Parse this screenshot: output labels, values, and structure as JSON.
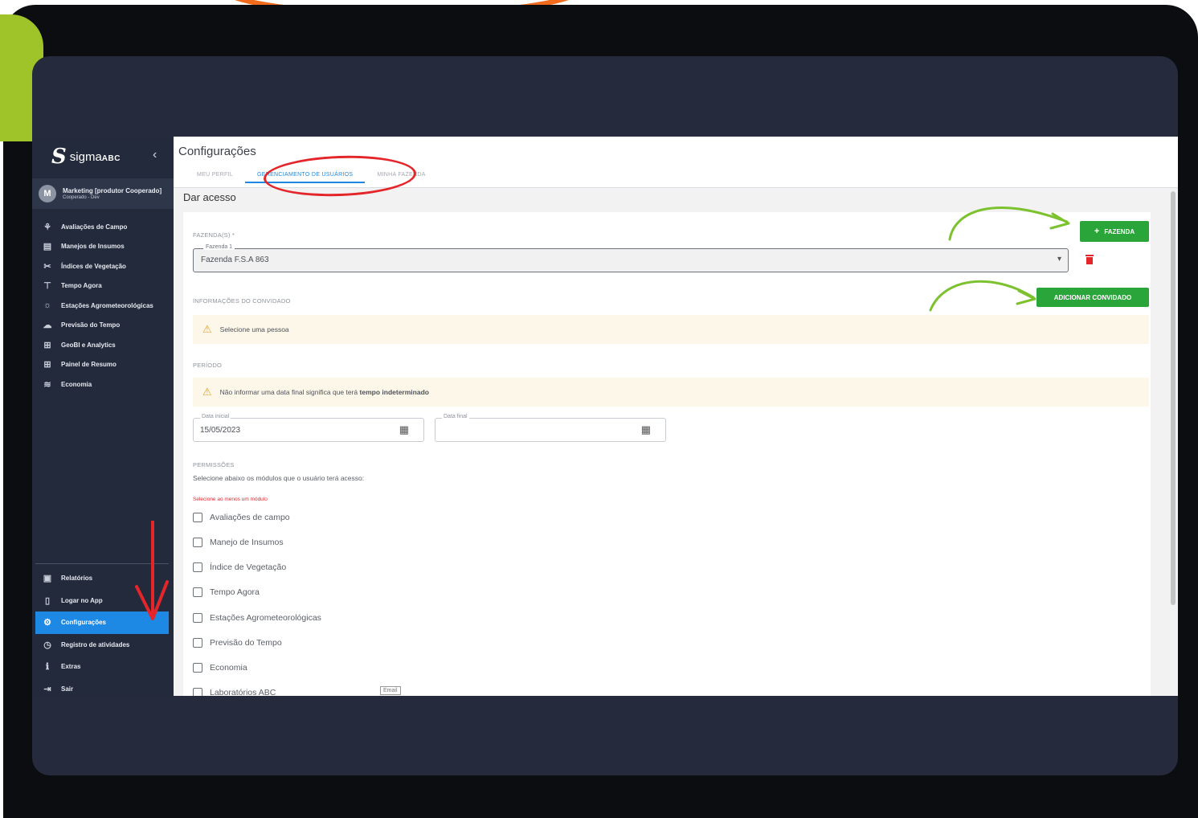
{
  "brand": {
    "logo_mark": "S",
    "logo_name": "sigma",
    "logo_suffix": "ABC"
  },
  "user": {
    "initial": "M",
    "name": "Marketing [produtor Cooperado]",
    "org": "Cooperado - Dev"
  },
  "sidebar": {
    "items": [
      {
        "label": "Avaliações de Campo",
        "icon": "field-icon"
      },
      {
        "label": "Manejos de Insumos",
        "icon": "supplies-icon"
      },
      {
        "label": "Índices de Vegetação",
        "icon": "vegetation-icon"
      },
      {
        "label": "Tempo Agora",
        "icon": "weather-station-icon"
      },
      {
        "label": "Estações Agrometeorológicas",
        "icon": "agro-station-icon"
      },
      {
        "label": "Previsão do Tempo",
        "icon": "forecast-icon"
      },
      {
        "label": "GeoBI e Analytics",
        "icon": "analytics-icon"
      },
      {
        "label": "Painel de Resumo",
        "icon": "dashboard-icon"
      },
      {
        "label": "Economia",
        "icon": "economy-icon"
      }
    ],
    "bottom_items": [
      {
        "label": "Relatórios",
        "icon": "reports-icon"
      },
      {
        "label": "Logar no App",
        "icon": "phone-icon"
      },
      {
        "label": "Configurações",
        "icon": "gear-icon",
        "active": true
      },
      {
        "label": "Registro de atividades",
        "icon": "history-icon"
      },
      {
        "label": "Extras",
        "icon": "info-icon"
      },
      {
        "label": "Sair",
        "icon": "logout-icon"
      }
    ]
  },
  "page": {
    "title": "Configurações",
    "tabs": [
      "Meu perfil",
      "Gerenciamento de usuários",
      "Minha fazenda"
    ],
    "active_tab": 1,
    "section_title": "Dar acesso"
  },
  "form": {
    "farms_label": "FAZENDA(S) *",
    "add_farm_button": "FAZENDA",
    "farm_field_legend": "Fazenda 1",
    "farm_field_value": "Fazenda F.S.A 863",
    "guest_label": "INFORMAÇÕES DO CONVIDADO",
    "add_guest_button": "ADICIONAR CONVIDADO",
    "guest_alert": "Selecione uma pessoa",
    "period_label": "PERÍODO",
    "period_alert_prefix": "Não informar uma data final significa que terá ",
    "period_alert_bold": "tempo indeterminado",
    "start_date_legend": "Data inicial",
    "start_date_value": "15/05/2023",
    "end_date_legend": "Data final",
    "end_date_value": "",
    "permissions_label": "PERMISSÕES",
    "permissions_desc": "Selecione abaixo os módulos que o usuário terá acesso:",
    "permissions_error": "Selecione ao menos um módulo",
    "modules": [
      "Avaliações de campo",
      "Manejo de Insumos",
      "Índice de Vegetação",
      "Tempo Agora",
      "Estações Agrometeorológicas",
      "Previsão do Tempo",
      "Economia",
      "Laboratórios ABC"
    ],
    "email_tag": "Email"
  },
  "colors": {
    "accent": "#1e88e5",
    "green_button": "#2aa53a",
    "annotation_red": "#e4262b",
    "annotation_green": "#7cc22e",
    "sidebar_bg": "#232a3b"
  }
}
